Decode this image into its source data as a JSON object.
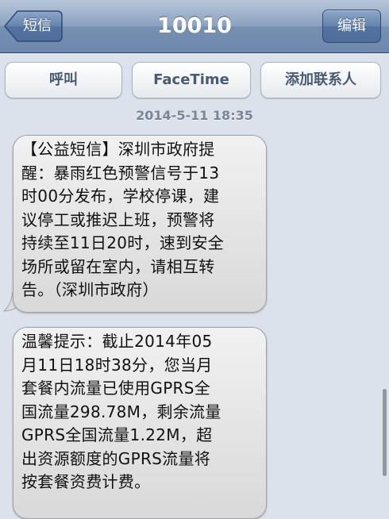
{
  "navbar": {
    "title": "10010",
    "back_label": "短信",
    "edit_label": "编辑"
  },
  "actions": {
    "call_label": "呼叫",
    "facetime_label": "FaceTime",
    "add_contact_label": "添加联系人"
  },
  "timestamp": "2014-5-11 18:35",
  "messages": [
    {
      "text": "【公益短信】深圳市政府提\n醒：暴雨红色预警信号于13\n时00分发布，学校停课，建\n议停工或推迟上班，预警将\n持续至11日20时，速到安全\n场所或留在室内，请相互转\n告。（深圳市政府）"
    },
    {
      "text": "温馨提示：截止2014年05\n月11日18时38分，您当月\n套餐内流量已使用GPRS全\n国流量298.78M，剩余流量\nGPRS全国流量1.22M，超\n出资源额度的GPRS流量将\n按套餐资费计费。"
    }
  ],
  "colors": {
    "navbar": "#7690b2",
    "background": "#dbe2ec",
    "bubble": "#e6e6e6"
  }
}
